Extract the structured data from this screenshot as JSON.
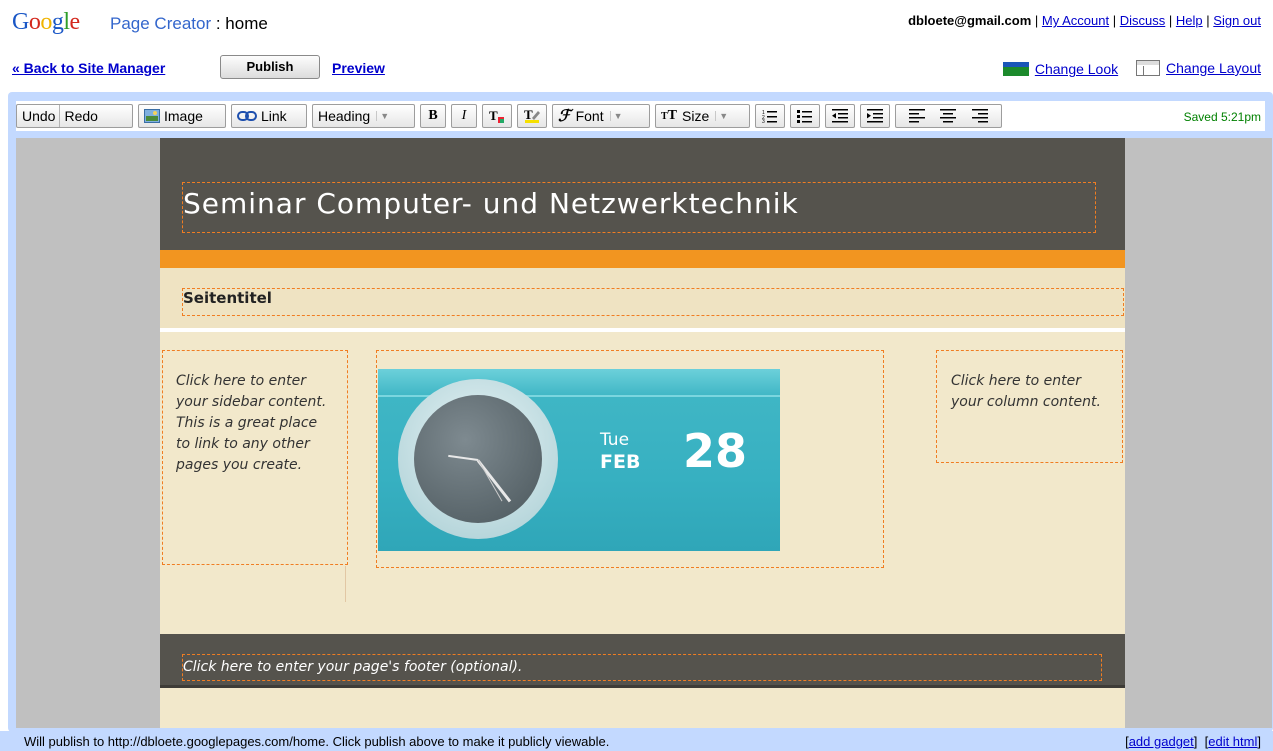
{
  "header": {
    "logo": "Google",
    "product": "Page Creator",
    "page_name": ": home",
    "email": "dbloete@gmail.com",
    "links": [
      "My Account",
      "Discuss",
      "Help",
      "Sign out"
    ],
    "sep": "|"
  },
  "nav": {
    "back": "« Back to Site Manager",
    "publish": "Publish",
    "preview": "Preview",
    "change_look": "Change Look",
    "change_layout": "Change Layout"
  },
  "toolbar": {
    "undo": "Undo",
    "redo": "Redo",
    "image": "Image",
    "link": "Link",
    "heading": "Heading",
    "bold": "B",
    "italic": "I",
    "font": "Font",
    "size": "Size",
    "saved": "Saved 5:21pm"
  },
  "page": {
    "site_title": "Seminar Computer- und Netzwerktechnik",
    "page_title": "Seitentitel",
    "sidebar": "Click here to enter your sidebar content. This is a great place to link to any other pages you create.",
    "column": "Click here to enter your column content.",
    "footer": "Click here to enter your page's footer (optional).",
    "clock": {
      "day": "Tue",
      "month": "FEB",
      "date": "28"
    }
  },
  "status": {
    "message": "Will publish to http://dbloete.googlepages.com/home. Click publish above to make it publicly viewable.",
    "add_gadget": "add gadget",
    "edit_html": "edit html"
  }
}
